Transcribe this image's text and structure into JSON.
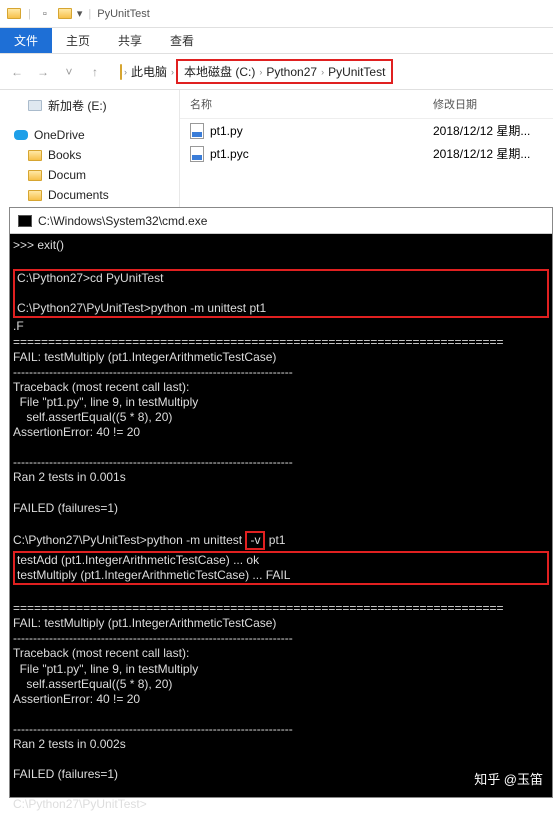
{
  "titlebar": {
    "title": "PyUnitTest",
    "dropdown_icon": "▾"
  },
  "tabs": {
    "file": "文件",
    "home": "主页",
    "share": "共享",
    "view": "查看"
  },
  "breadcrumb": {
    "this_pc": "此电脑",
    "drive": "本地磁盘 (C:)",
    "folder1": "Python27",
    "folder2": "PyUnitTest"
  },
  "sidebar": {
    "new_volume": "新加卷 (E:)",
    "onedrive": "OneDrive",
    "books": "Books",
    "docum": "Docum",
    "documents": "Documents"
  },
  "columns": {
    "name": "名称",
    "date": "修改日期"
  },
  "files": [
    {
      "name": "pt1.py",
      "date": "2018/12/12 星期..."
    },
    {
      "name": "pt1.pyc",
      "date": "2018/12/12 星期..."
    }
  ],
  "cmd": {
    "title": "C:\\Windows\\System32\\cmd.exe",
    "exit": ">>> exit()",
    "cd": "C:\\Python27>cd PyUnitTest",
    "run1": "C:\\Python27\\PyUnitTest>python -m unittest pt1",
    "dotf": ".F",
    "eqline": "======================================================================",
    "fail_header": "FAIL: testMultiply (pt1.IntegerArithmeticTestCase)",
    "dashline": "----------------------------------------------------------------------",
    "tb1": "Traceback (most recent call last):",
    "tb2": "  File \"pt1.py\", line 9, in testMultiply",
    "tb3": "    self.assertEqual((5 * 8), 20)",
    "tb4": "AssertionError: 40 != 20",
    "ran1": "Ran 2 tests in 0.001s",
    "failed": "FAILED (failures=1)",
    "run2_prefix": "C:\\Python27\\PyUnitTest>python -m unittest ",
    "run2_v": "-v",
    "run2_suffix": " pt1",
    "verbose1": "testAdd (pt1.IntegerArithmeticTestCase) ... ok",
    "verbose2": "testMultiply (pt1.IntegerArithmeticTestCase) ... FAIL",
    "ran2": "Ran 2 tests in 0.002s",
    "prompt": "C:\\Python27\\PyUnitTest>"
  },
  "watermark": "知乎 @玉笛"
}
